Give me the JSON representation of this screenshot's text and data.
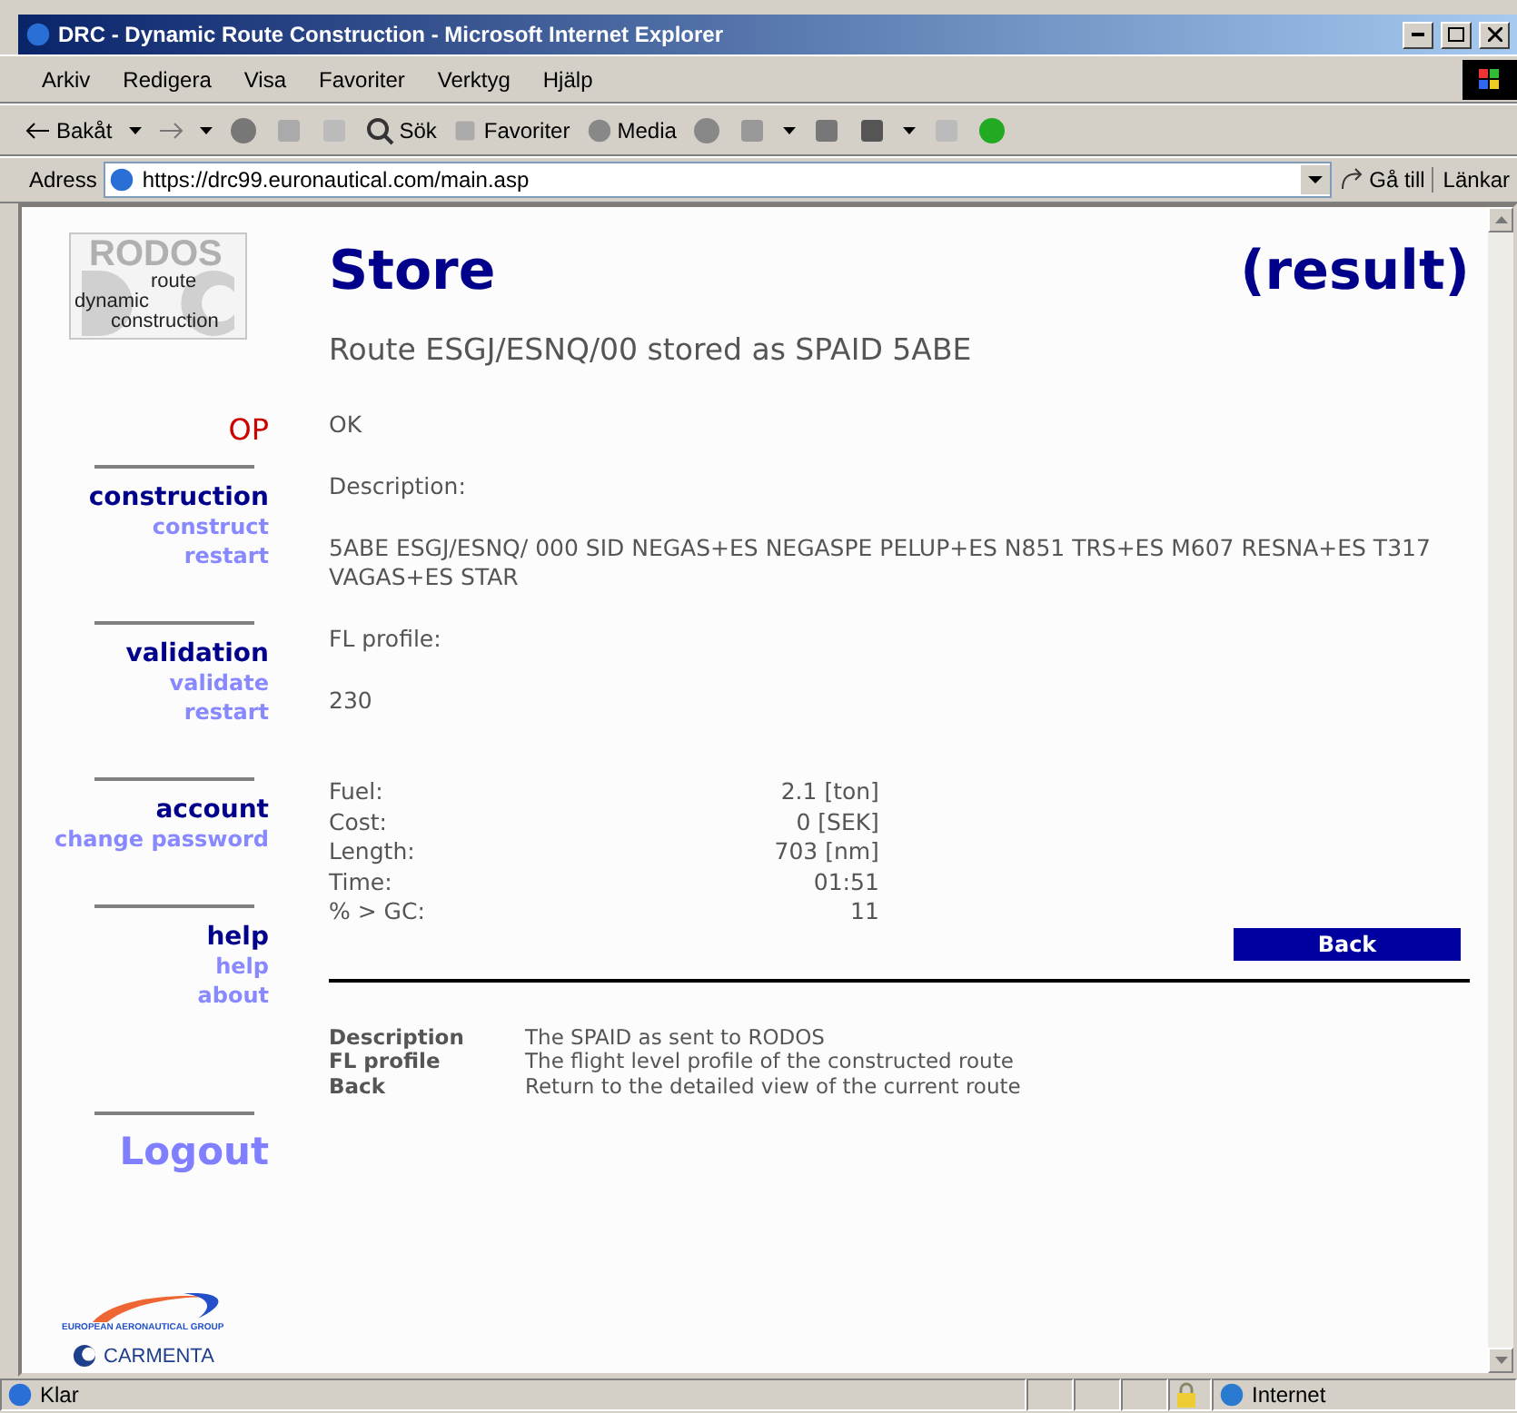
{
  "window": {
    "title": "DRC - Dynamic Route Construction - Microsoft Internet Explorer"
  },
  "menu": [
    "Arkiv",
    "Redigera",
    "Visa",
    "Favoriter",
    "Verktyg",
    "Hjälp"
  ],
  "toolbar": {
    "back": "Bakåt",
    "search": "Sök",
    "favorites": "Favoriter",
    "media": "Media"
  },
  "address": {
    "label": "Adress",
    "url": "https://drc99.euronautical.com/main.asp",
    "go": "Gå till",
    "links": "Länkar"
  },
  "sidebar": {
    "logo": {
      "title": "RODOS",
      "lines": [
        "route",
        "dynamic",
        "construction"
      ]
    },
    "mode": "OP",
    "sections": [
      {
        "title": "construction",
        "links": [
          "construct",
          "restart"
        ]
      },
      {
        "title": "validation",
        "links": [
          "validate",
          "restart"
        ]
      },
      {
        "title": "account",
        "links": [
          "change password"
        ]
      },
      {
        "title": "help",
        "links": [
          "help",
          "about"
        ]
      }
    ],
    "logout": "Logout",
    "partners": {
      "group": "EUROPEAN AERONAUTICAL GROUP",
      "company": "CARMENTA"
    }
  },
  "main": {
    "title": "Store",
    "result": "(result)",
    "subtitle": "Route ESGJ/ESNQ/00 stored as SPAID 5ABE",
    "status": "OK",
    "description_label": "Description:",
    "description": "5ABE ESGJ/ESNQ/ 000 SID NEGAS+ES NEGASPE PELUP+ES N851 TRS+ES M607 RESNA+ES T317 VAGAS+ES STAR",
    "fl_label": "FL profile:",
    "fl": "230",
    "stats": [
      {
        "label": "Fuel:",
        "value": "2.1 [ton]"
      },
      {
        "label": "Cost:",
        "value": "0 [SEK]"
      },
      {
        "label": "Length:",
        "value": "703 [nm]"
      },
      {
        "label": "Time:",
        "value": "01:51"
      },
      {
        "label": "% > GC:",
        "value": "11"
      }
    ],
    "back": "Back",
    "legend": [
      {
        "term": "Description",
        "text": "The SPAID as sent to RODOS"
      },
      {
        "term": "FL profile",
        "text": "The flight level profile of the constructed route"
      },
      {
        "term": "Back",
        "text": "Return to the detailed view of the current route"
      }
    ]
  },
  "status_bar": {
    "text": "Klar",
    "zone": "Internet"
  }
}
